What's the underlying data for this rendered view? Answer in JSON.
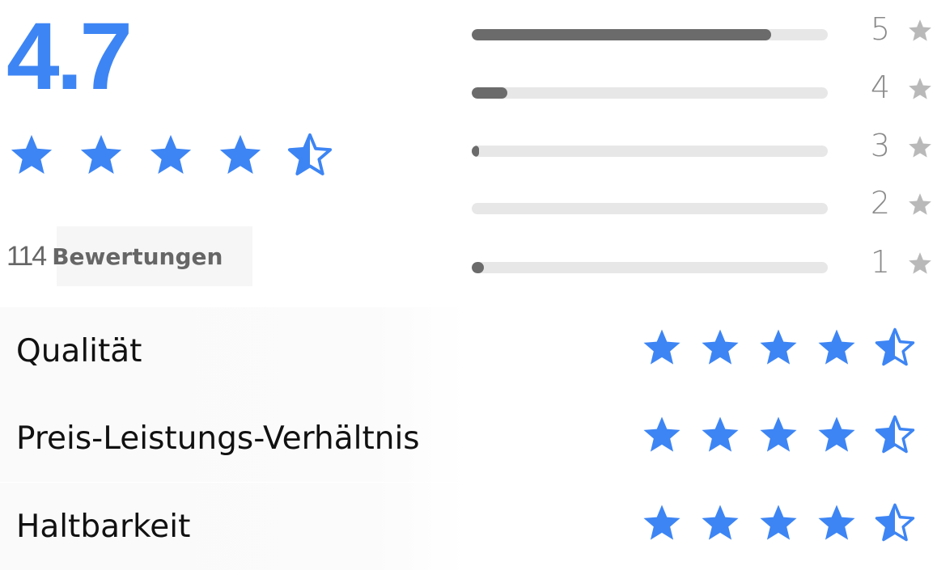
{
  "rating_summary": {
    "average_score": "4.7",
    "average_value": 4.7,
    "max_score": 5,
    "review_count": "114",
    "review_count_label": "Bewertungen",
    "accent_color": "#3d85f4"
  },
  "distribution": [
    {
      "stars": "5",
      "fraction": 0.84
    },
    {
      "stars": "4",
      "fraction": 0.1
    },
    {
      "stars": "3",
      "fraction": 0.02
    },
    {
      "stars": "2",
      "fraction": 0.0
    },
    {
      "stars": "1",
      "fraction": 0.035
    }
  ],
  "distribution_bar_color": "#6b6b6b",
  "distribution_track_color": "#e7e7e7",
  "criteria": [
    {
      "label": "Qualität",
      "rating": 4.5
    },
    {
      "label": "Preis-Leistungs-Verhältnis",
      "rating": 4.5
    },
    {
      "label": "Haltbarkeit",
      "rating": 4.5
    }
  ],
  "icons": {
    "rating_star": "star-icon",
    "half_star": "half-star-icon",
    "distribution_star": "star-icon"
  }
}
